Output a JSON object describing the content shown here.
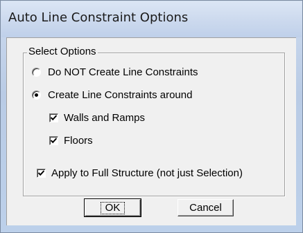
{
  "window": {
    "title": "Auto Line Constraint Options"
  },
  "group": {
    "legend": "Select Options"
  },
  "options": {
    "do_not_create": {
      "label": "Do NOT Create Line Constraints",
      "selected": false
    },
    "create_around": {
      "label": "Create Line Constraints around",
      "selected": true
    },
    "walls_ramps": {
      "label": "Walls and Ramps",
      "checked": true
    },
    "floors": {
      "label": "Floors",
      "checked": true
    },
    "apply_full": {
      "label": "Apply to Full Structure (not just Selection)",
      "checked": true
    }
  },
  "buttons": {
    "ok_label": "OK",
    "cancel_label": "Cancel"
  }
}
